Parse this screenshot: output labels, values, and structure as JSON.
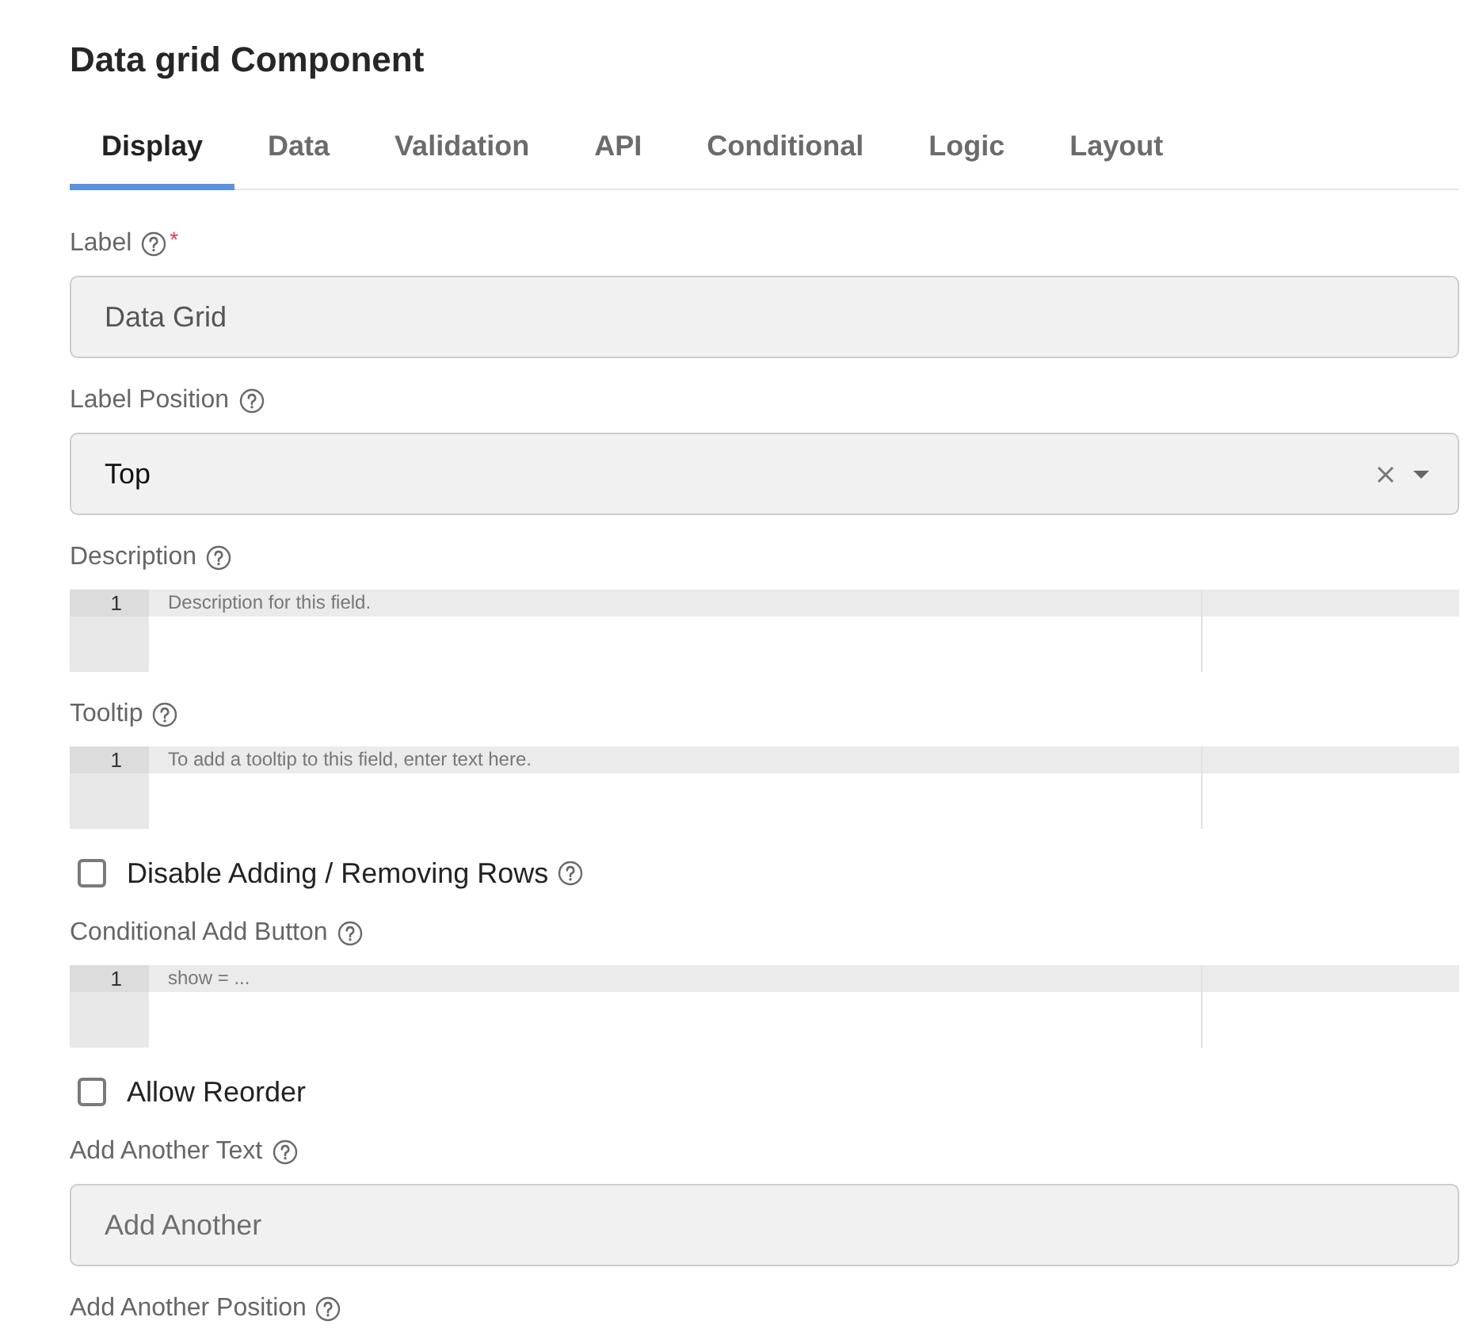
{
  "title": "Data grid Component",
  "tabs": [
    {
      "label": "Display",
      "selected": true
    },
    {
      "label": "Data",
      "selected": false
    },
    {
      "label": "Validation",
      "selected": false
    },
    {
      "label": "API",
      "selected": false
    },
    {
      "label": "Conditional",
      "selected": false
    },
    {
      "label": "Logic",
      "selected": false
    },
    {
      "label": "Layout",
      "selected": false
    }
  ],
  "fields": [
    {
      "kind": "text",
      "label": "Label",
      "help": true,
      "required_mark": "*",
      "value": "Data Grid"
    },
    {
      "kind": "select",
      "label": "Label Position",
      "help": true,
      "value": "Top"
    },
    {
      "kind": "code",
      "label": "Description",
      "help": true,
      "line_number": "1",
      "placeholder": "Description for this field."
    },
    {
      "kind": "code",
      "label": "Tooltip",
      "help": true,
      "line_number": "1",
      "placeholder": "To add a tooltip to this field, enter text here."
    },
    {
      "kind": "checkbox",
      "label": "Disable Adding / Removing Rows",
      "help": true,
      "checked": false
    },
    {
      "kind": "code",
      "label": "Conditional Add Button",
      "help": true,
      "line_number": "1",
      "placeholder": "show = ..."
    },
    {
      "kind": "checkbox",
      "label": "Allow Reorder",
      "help": false,
      "checked": false
    },
    {
      "kind": "text",
      "label": "Add Another Text",
      "help": true,
      "placeholder": "Add Another"
    },
    {
      "kind": "label",
      "label": "Add Another Position",
      "help": true
    }
  ]
}
